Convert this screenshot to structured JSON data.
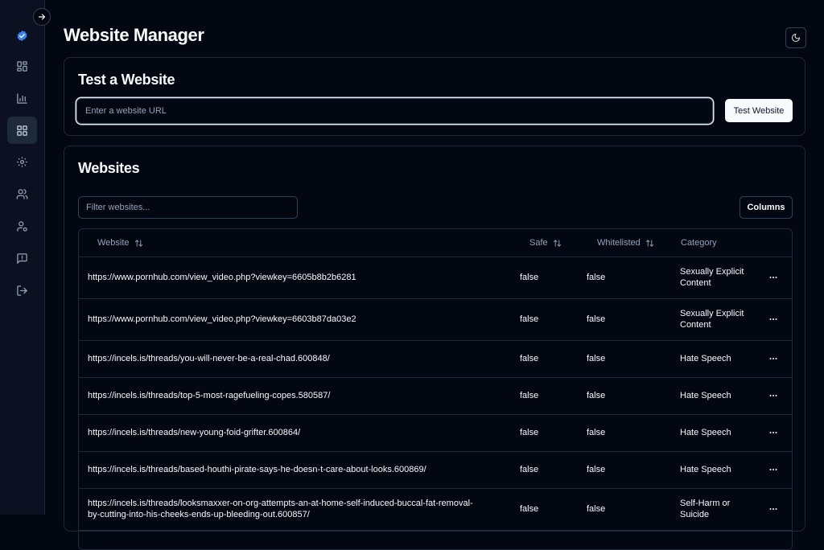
{
  "page": {
    "title": "Website Manager"
  },
  "test_card": {
    "title": "Test a Website",
    "input_placeholder": "Enter a website URL",
    "input_value": "",
    "button_label": "Test Website"
  },
  "websites_card": {
    "title": "Websites",
    "filter_placeholder": "Filter websites...",
    "columns_button": "Columns",
    "headers": {
      "website": "Website",
      "safe": "Safe",
      "whitelisted": "Whitelisted",
      "category": "Category"
    },
    "rows": [
      {
        "url": "https://www.pornhub.com/view_video.php?viewkey=6605b8b2b6281",
        "safe": "false",
        "whitelisted": "false",
        "category": "Sexually Explicit Content"
      },
      {
        "url": "https://www.pornhub.com/view_video.php?viewkey=6603b87da03e2",
        "safe": "false",
        "whitelisted": "false",
        "category": "Sexually Explicit Content"
      },
      {
        "url": "https://incels.is/threads/you-will-never-be-a-real-chad.600848/",
        "safe": "false",
        "whitelisted": "false",
        "category": "Hate Speech"
      },
      {
        "url": "https://incels.is/threads/top-5-most-ragefueling-copes.580587/",
        "safe": "false",
        "whitelisted": "false",
        "category": "Hate Speech"
      },
      {
        "url": "https://incels.is/threads/new-young-foid-grifter.600864/",
        "safe": "false",
        "whitelisted": "false",
        "category": "Hate Speech"
      },
      {
        "url": "https://incels.is/threads/based-houthi-pirate-says-he-doesn-t-care-about-looks.600869/",
        "safe": "false",
        "whitelisted": "false",
        "category": "Hate Speech"
      },
      {
        "url": "https://incels.is/threads/looksmaxxer-on-org-attempts-an-at-home-self-induced-buccal-fat-removal-by-cutting-into-his-cheeks-ends-up-bleeding-out.600857/",
        "safe": "false",
        "whitelisted": "false",
        "category": "Self-Harm or Suicide"
      }
    ]
  },
  "sidebar": {
    "icons": [
      "check-badge-icon",
      "dashboard-icon",
      "bar-chart-icon",
      "grid-icon",
      "gear-icon",
      "users-icon",
      "user-settings-icon",
      "message-icon",
      "logout-icon"
    ]
  },
  "colors": {
    "background": "#030712",
    "sidebar": "#0b1120",
    "border": "#1e293b",
    "accent": "#3b82f6",
    "text": "#f8fafc",
    "muted": "#94a3b8"
  }
}
